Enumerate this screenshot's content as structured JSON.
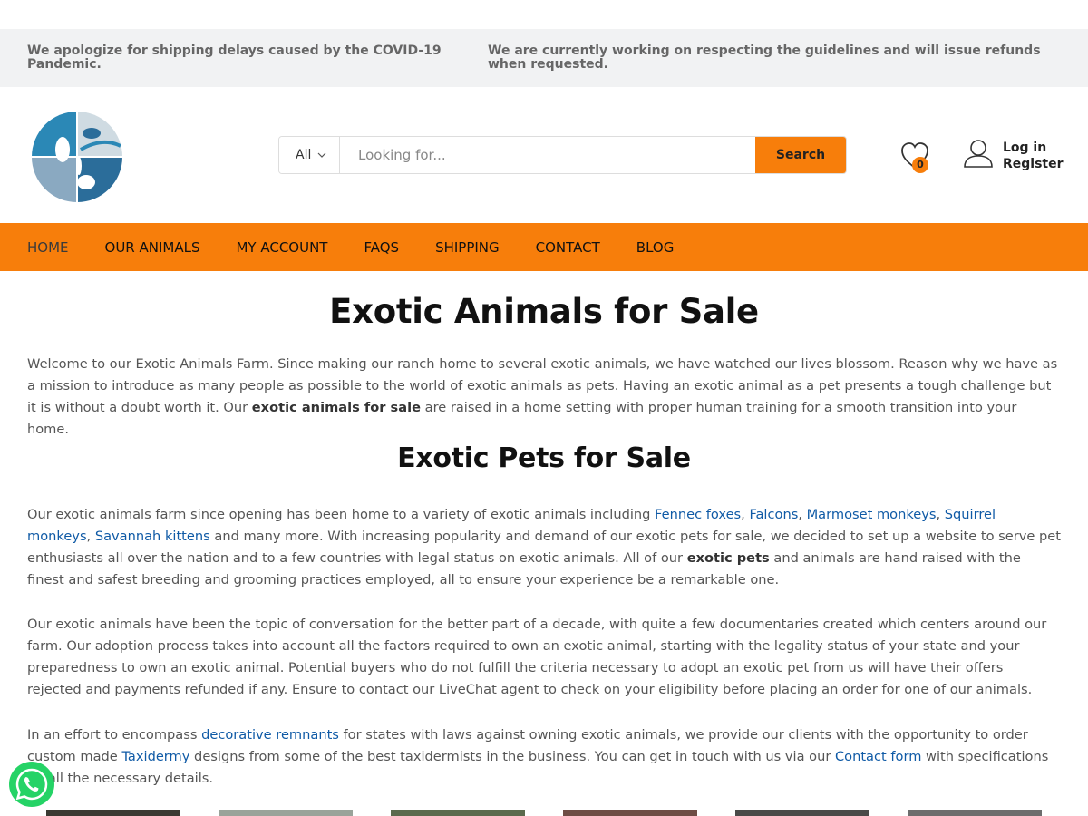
{
  "notices": {
    "left": "We apologize for shipping delays caused by the COVID-19 Pandemic.",
    "right": "We are currently working on respecting the guidelines and will issue refunds when requested."
  },
  "search": {
    "category": "All",
    "placeholder": "Looking for...",
    "button": "Search"
  },
  "header": {
    "wishlist_count": "0",
    "login": "Log in",
    "register": "Register"
  },
  "nav": {
    "items": [
      "HOME",
      "OUR ANIMALS",
      "MY ACCOUNT",
      "FAQS",
      "SHIPPING",
      "CONTACT",
      "BLOG"
    ]
  },
  "content": {
    "title": "Exotic Animals for Sale",
    "p1_a": "Welcome to our Exotic Animals Farm. Since making our ranch home to several exotic animals, we have watched our lives blossom. Reason why we have as a mission to introduce as many people as possible to the world of exotic animals as pets. Having an exotic animal as a pet presents a tough challenge but it is without a doubt worth it. Our ",
    "p1_b": "exotic animals for sale",
    "p1_c": " are raised in a home setting with proper human training for a smooth transition into your home.",
    "subtitle": "Exotic Pets for Sale",
    "p2_a": "Our exotic animals farm since opening has been home to a variety of exotic animals including ",
    "p2_links": [
      "Fennec foxes",
      "Falcons",
      "Marmoset monkeys",
      "Squirrel monkeys",
      "Savannah kittens"
    ],
    "p2_b": " and many more. With increasing popularity and demand of our exotic pets for sale, we decided to set up a website to serve pet enthusiasts all over the nation and to a few countries with legal status on exotic animals. All of our ",
    "p2_bold": "exotic pets",
    "p2_c": " and animals are hand raised with the finest and safest breeding and grooming practices employed, all to ensure your experience be a remarkable one.",
    "p3": "Our exotic animals have been the topic of conversation for the better part of a decade, with quite a few documentaries created which centers around our farm. Our adoption process takes into account all the factors required to own an exotic animal, starting with the legality status of your state and your preparedness to own an exotic animal. Potential buyers who do not fulfill the criteria necessary to adopt an exotic pet from us will have their offers rejected and payments refunded if any. Ensure to contact our LiveChat agent to check on your eligibility before placing an order for one of our animals.",
    "p4_a": "In an effort to encompass ",
    "p4_link1": "decorative remnants",
    "p4_b": " for states with laws against owning exotic animals, we provide our clients with the opportunity to order custom made ",
    "p4_link2": "Taxidermy",
    "p4_c": " designs from some of the best taxidermists in the business. You can get in touch with us via our ",
    "p4_link3": "Contact form",
    "p4_d": " with specifications on all the necessary details."
  },
  "thumb_colors": [
    "#3b3a33",
    "#9aa39a",
    "#5b6a4d",
    "#6e4d45",
    "#4a4a48",
    "#6d6d6d"
  ],
  "colors": {
    "accent": "#f77e0b",
    "link": "#0f5aa6",
    "whatsapp": "#25d366"
  }
}
